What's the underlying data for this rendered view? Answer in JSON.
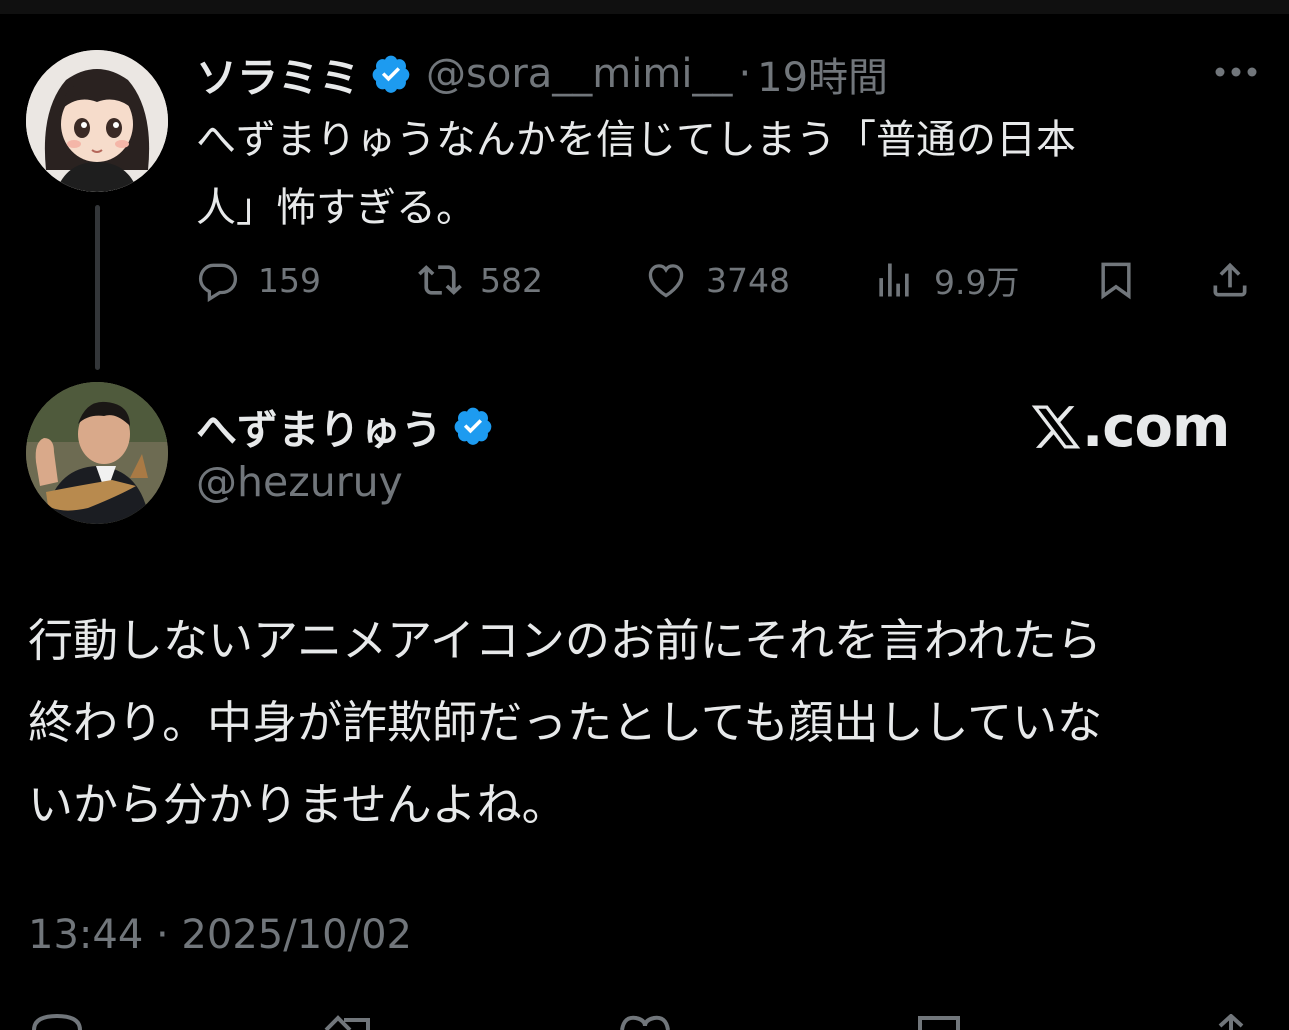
{
  "parent_tweet": {
    "display_name": "ソラミミ",
    "handle": "@sora__mimi__",
    "separator": "·",
    "time": "19時間",
    "text": "へずまりゅうなんかを信じてしまう「普通の日本\n人」怖すぎる。",
    "verified": true,
    "stats": {
      "replies": "159",
      "retweets": "582",
      "likes": "3748",
      "views": "9.9万"
    }
  },
  "main_tweet": {
    "display_name": "へずまりゅう",
    "handle": "@hezuruy",
    "verified": true,
    "watermark": ".com",
    "text": "行動しないアニメアイコンのお前にそれを言われたら\n終わり。中身が詐欺師だったとしても顔出ししていな\nいから分かりませんよね。",
    "timestamp": "13:44 · 2025/10/02"
  },
  "colors": {
    "background": "#000000",
    "primary_text": "#e7e9ea",
    "secondary_text": "#71767b",
    "verified_blue": "#1d9bf0"
  },
  "icons": [
    "more-icon",
    "reply-icon",
    "retweet-icon",
    "like-icon",
    "views-icon",
    "bookmark-icon",
    "share-icon",
    "verified-icon",
    "x-logo-icon"
  ]
}
